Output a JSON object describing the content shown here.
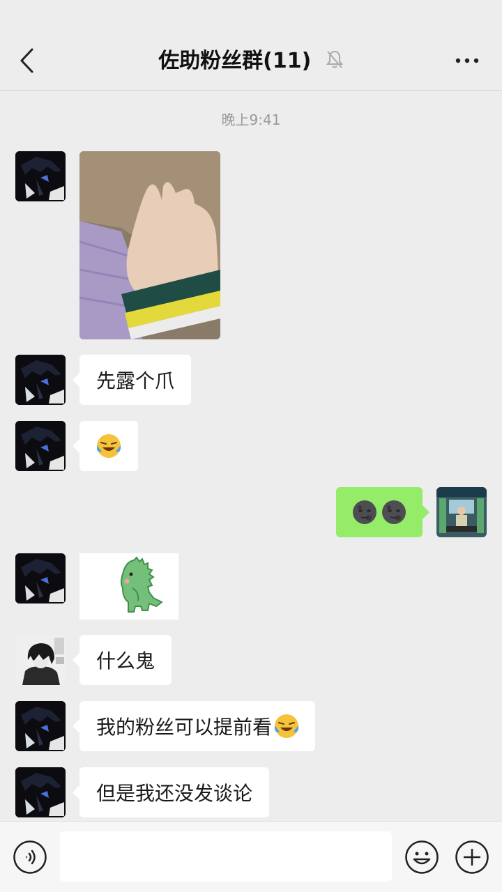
{
  "header": {
    "title": "佐助粉丝群(11)"
  },
  "timestamp": "晚上9:41",
  "messages": {
    "m2": "先露个爪",
    "m5": "什么鬼",
    "m6_text": "我的粉丝可以提前看",
    "m7": "但是我还没发谈论"
  },
  "icons": {
    "back": "chevron-left-icon",
    "mute": "bell-off-icon",
    "more": "more-icon",
    "voice": "voice-icon",
    "emoji": "emoji-icon",
    "plus": "plus-icon"
  },
  "colors": {
    "background": "#ededed",
    "sent_bubble": "#95ec69",
    "received_bubble": "#ffffff"
  }
}
